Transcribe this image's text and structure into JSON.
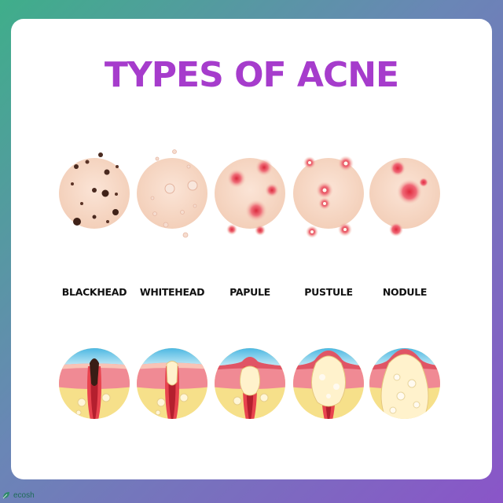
{
  "title": "TYPES OF ACNE",
  "types": [
    {
      "label": "BLACKHEAD"
    },
    {
      "label": "WHITEHEAD"
    },
    {
      "label": "PAPULE"
    },
    {
      "label": "PUSTULE"
    },
    {
      "label": "NODULE"
    }
  ],
  "brand": {
    "text": "ecosh",
    "icon": "leaf-icon"
  },
  "colors": {
    "title": "#a63ccc",
    "skin": "#f6d8c6",
    "inflammation": "#e0434f",
    "epidermis": "#f28a93",
    "dermis": "#f6e08a",
    "sky": "#5cc3e6"
  }
}
